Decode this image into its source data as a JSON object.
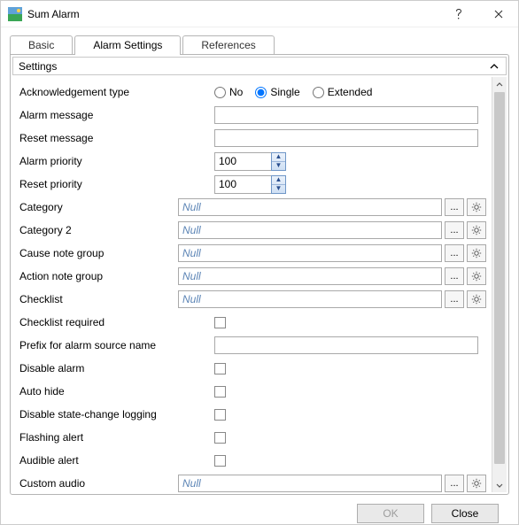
{
  "title": "Sum Alarm",
  "tabs": {
    "basic": "Basic",
    "alarm_settings": "Alarm Settings",
    "references": "References",
    "active": "alarm_settings"
  },
  "section_header": "Settings",
  "labels": {
    "ack_type": "Acknowledgement type",
    "alarm_msg": "Alarm message",
    "reset_msg": "Reset message",
    "alarm_priority": "Alarm priority",
    "reset_priority": "Reset priority",
    "category": "Category",
    "category2": "Category 2",
    "cause_note": "Cause note group",
    "action_note": "Action note group",
    "checklist": "Checklist",
    "checklist_req": "Checklist required",
    "prefix_src": "Prefix for alarm source name",
    "disable_alarm": "Disable alarm",
    "auto_hide": "Auto hide",
    "disable_sclog": "Disable state-change logging",
    "flashing": "Flashing alert",
    "audible": "Audible alert",
    "custom_audio": "Custom audio"
  },
  "ack_options": {
    "no": "No",
    "single": "Single",
    "extended": "Extended"
  },
  "values": {
    "ack_selected": "single",
    "alarm_msg": "",
    "reset_msg": "",
    "alarm_priority": "100",
    "reset_priority": "100",
    "prefix_src": "",
    "checklist_req": false,
    "disable_alarm": false,
    "auto_hide": false,
    "disable_sclog": false,
    "flashing": false,
    "audible": false
  },
  "null_placeholder": "Null",
  "browse_btn": "...",
  "buttons": {
    "ok": "OK",
    "close": "Close"
  }
}
